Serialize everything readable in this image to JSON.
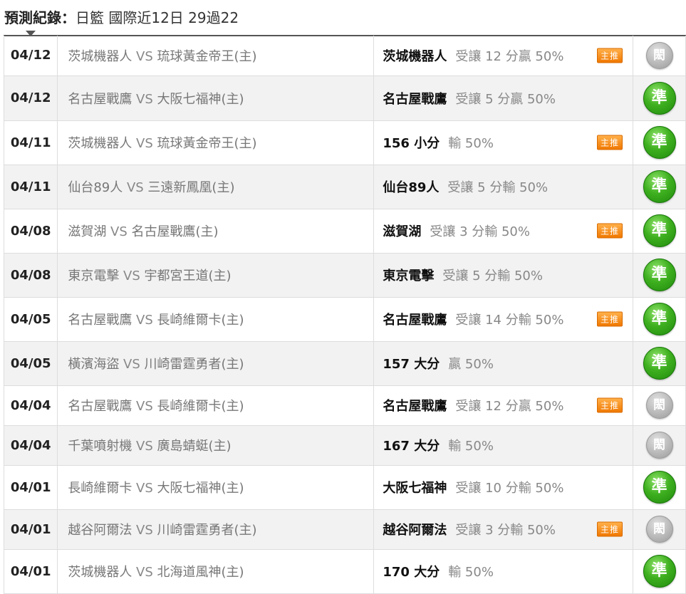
{
  "header": {
    "label": "預測紀錄：",
    "title": "日籃 國際近12日 29過22"
  },
  "badge_text": "主推",
  "rows": [
    {
      "date": "04/12",
      "home": "茨城機器人",
      "away": "琉球黃金帝王(主)",
      "pick_team": "茨城機器人",
      "pick_detail": "受讓 12 分贏 50%",
      "featured": true,
      "result": "閎",
      "result_type": "push"
    },
    {
      "date": "04/12",
      "home": "名古屋戰鷹",
      "away": "大阪七福神(主)",
      "pick_team": "名古屋戰鷹",
      "pick_detail": "受讓 5 分贏 50%",
      "featured": false,
      "result": "準",
      "result_type": "win"
    },
    {
      "date": "04/11",
      "home": "茨城機器人",
      "away": "琉球黃金帝王(主)",
      "pick_team": "156 小分",
      "pick_detail": "輸 50%",
      "featured": true,
      "result": "準",
      "result_type": "win"
    },
    {
      "date": "04/11",
      "home": "仙台89人",
      "away": "三遠新鳳凰(主)",
      "pick_team": "仙台89人",
      "pick_detail": "受讓 5 分輸 50%",
      "featured": false,
      "result": "準",
      "result_type": "win"
    },
    {
      "date": "04/08",
      "home": "滋賀湖",
      "away": "名古屋戰鷹(主)",
      "pick_team": "滋賀湖",
      "pick_detail": "受讓 3 分輸 50%",
      "featured": true,
      "result": "準",
      "result_type": "win"
    },
    {
      "date": "04/08",
      "home": "東京電擊",
      "away": "宇都宮王道(主)",
      "pick_team": "東京電擊",
      "pick_detail": "受讓 5 分輸 50%",
      "featured": false,
      "result": "準",
      "result_type": "win"
    },
    {
      "date": "04/05",
      "home": "名古屋戰鷹",
      "away": "長崎維爾卡(主)",
      "pick_team": "名古屋戰鷹",
      "pick_detail": "受讓 14 分輸 50%",
      "featured": true,
      "result": "準",
      "result_type": "win"
    },
    {
      "date": "04/05",
      "home": "橫濱海盜",
      "away": "川崎雷霆勇者(主)",
      "pick_team": "157 大分",
      "pick_detail": "贏 50%",
      "featured": false,
      "result": "準",
      "result_type": "win"
    },
    {
      "date": "04/04",
      "home": "名古屋戰鷹",
      "away": "長崎維爾卡(主)",
      "pick_team": "名古屋戰鷹",
      "pick_detail": "受讓 12 分贏 50%",
      "featured": true,
      "result": "閎",
      "result_type": "push"
    },
    {
      "date": "04/04",
      "home": "千葉噴射機",
      "away": "廣島蜻蜓(主)",
      "pick_team": "167 大分",
      "pick_detail": "輸 50%",
      "featured": false,
      "result": "閎",
      "result_type": "push"
    },
    {
      "date": "04/01",
      "home": "長崎維爾卡",
      "away": "大阪七福神(主)",
      "pick_team": "大阪七福神",
      "pick_detail": "受讓 10 分輸 50%",
      "featured": false,
      "result": "準",
      "result_type": "win"
    },
    {
      "date": "04/01",
      "home": "越谷阿爾法",
      "away": "川崎雷霆勇者(主)",
      "pick_team": "越谷阿爾法",
      "pick_detail": "受讓 3 分輸 50%",
      "featured": true,
      "result": "閎",
      "result_type": "push"
    },
    {
      "date": "04/01",
      "home": "茨城機器人",
      "away": "北海道風神(主)",
      "pick_team": "170 大分",
      "pick_detail": "輸 50%",
      "featured": false,
      "result": "準",
      "result_type": "win"
    }
  ]
}
